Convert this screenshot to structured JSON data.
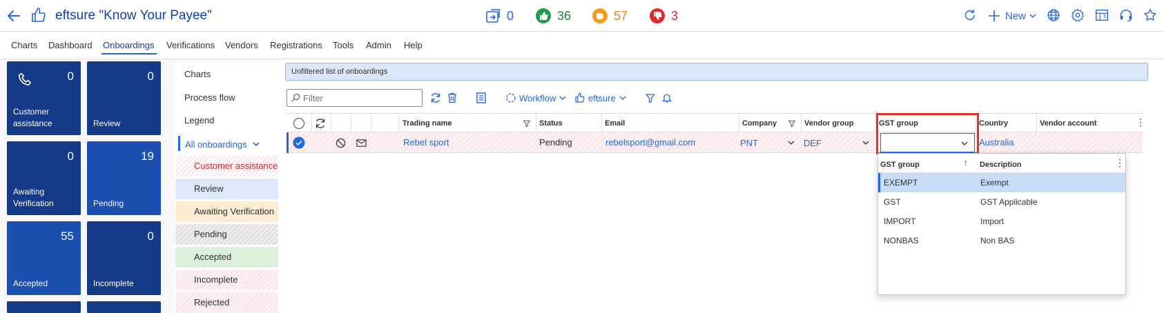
{
  "header": {
    "title": "eftsure \"Know Your Payee\"",
    "stats": [
      {
        "icon": "onboard-icon",
        "value": "0",
        "color": "#2266e3"
      },
      {
        "icon": "thumbs-up-icon",
        "value": "36",
        "color": "#1e7e34"
      },
      {
        "icon": "thumbs-side-icon",
        "value": "57",
        "color": "#e8891a"
      },
      {
        "icon": "thumbs-down-icon",
        "value": "3",
        "color": "#d9262c"
      }
    ],
    "new_label": "New"
  },
  "nav": {
    "items": [
      "Charts",
      "Dashboard",
      "Onboardings",
      "Verifications",
      "Vendors",
      "Registrations",
      "Tools",
      "Admin",
      "Help"
    ],
    "active": "Onboardings"
  },
  "tiles": [
    {
      "count": "0",
      "label": "Customer assistance"
    },
    {
      "count": "0",
      "label": "Review"
    },
    {
      "count": "0",
      "label": "Awaiting Verification"
    },
    {
      "count": "19",
      "label": "Pending"
    },
    {
      "count": "55",
      "label": "Accepted"
    },
    {
      "count": "0",
      "label": "Incomplete"
    }
  ],
  "left_menu": {
    "charts": "Charts",
    "process_flow": "Process flow",
    "legend": "Legend",
    "all_onboardings": "All onboardings",
    "filters": [
      "Customer assistance",
      "Review",
      "Awaiting Verification",
      "Pending",
      "Accepted",
      "Incomplete",
      "Rejected"
    ]
  },
  "main": {
    "banner": "Unfiltered list of onboardings",
    "filter_placeholder": "Filter",
    "workflow_label": "Workflow",
    "eftsure_label": "eftsure"
  },
  "grid": {
    "columns": [
      "Trading name",
      "Status",
      "Email",
      "Company",
      "Vendor group",
      "GST group",
      "Country",
      "Vendor account"
    ],
    "row": {
      "trading_name": "Rebel sport",
      "status": "Pending",
      "email": "rebelsport@gmail.com",
      "company": "PNT",
      "vendor_group": "DEF",
      "gst_group": "",
      "country": "Australia",
      "vendor_account": ""
    }
  },
  "gst_lookup": {
    "col_group": "GST group",
    "col_desc": "Description",
    "rows": [
      {
        "group": "EXEMPT",
        "description": "Exempt"
      },
      {
        "group": "GST",
        "description": "GST Applicable"
      },
      {
        "group": "IMPORT",
        "description": "Import"
      },
      {
        "group": "NONBAS",
        "description": "Non BAS"
      }
    ],
    "selected": "EXEMPT"
  }
}
